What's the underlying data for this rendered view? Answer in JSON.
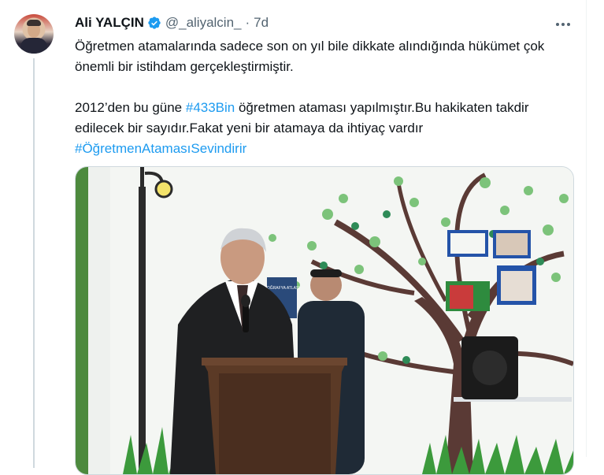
{
  "tweet": {
    "author_name": "Ali YALÇIN",
    "handle": "@_aliyalcin_",
    "separator": "·",
    "time": "7d",
    "paragraph1": "Öğretmen atamalarında sadece son on yıl bile dikkate alındığında hükümet çok önemli bir istihdam gerçekleştirmiştir.",
    "p2_before": "2012’den bu güne ",
    "p2_hashtag1": "#433Bin",
    "p2_after": " öğretmen ataması yapılmıştır.Bu hakikaten takdir edilecek bir sayıdır.Fakat yeni bir atamaya da ihtiyaç vardır ",
    "p2_hashtag2": "#ÖğretmenAtamasıSevindirir",
    "media_book_title": "COĞRAFYA ATLASI"
  },
  "icons": {
    "verified": "verified-badge-icon",
    "more": "more-options-icon"
  },
  "colors": {
    "accent": "#1d9bf0",
    "secondary_text": "#536471",
    "border": "#cfd9de"
  }
}
